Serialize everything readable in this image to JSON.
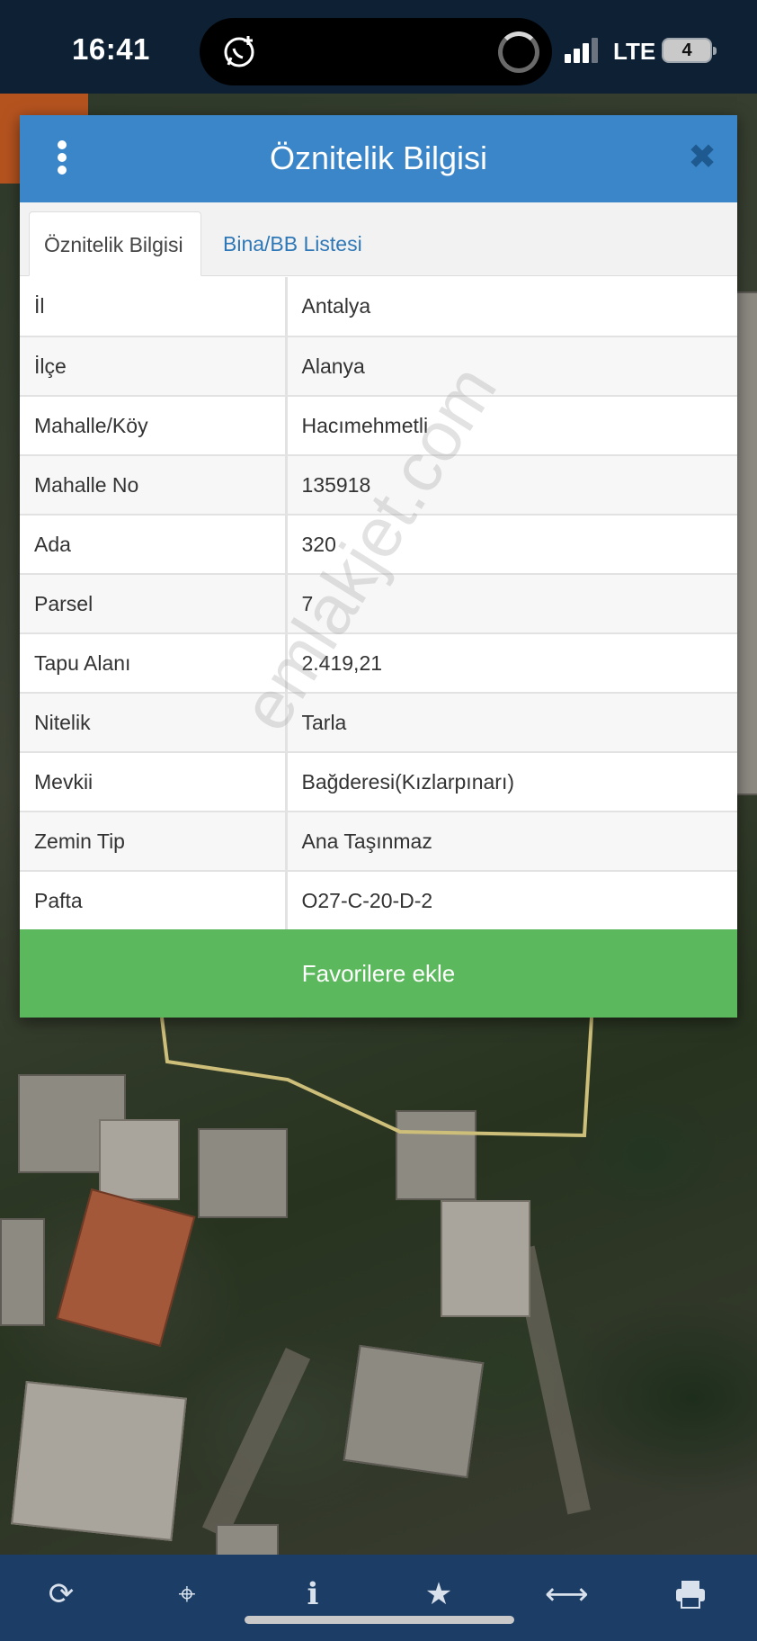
{
  "status_bar": {
    "time": "16:41",
    "network": "LTE",
    "battery": "4"
  },
  "dialog": {
    "title": "Öznitelik Bilgisi",
    "tabs": [
      {
        "label": "Öznitelik Bilgisi",
        "active": true
      },
      {
        "label": "Bina/BB Listesi",
        "active": false
      }
    ],
    "rows": [
      {
        "key": "İl",
        "value": "Antalya"
      },
      {
        "key": "İlçe",
        "value": "Alanya"
      },
      {
        "key": "Mahalle/Köy",
        "value": "Hacımehmetli"
      },
      {
        "key": "Mahalle No",
        "value": "135918"
      },
      {
        "key": "Ada",
        "value": "320"
      },
      {
        "key": "Parsel",
        "value": "7"
      },
      {
        "key": "Tapu Alanı",
        "value": "2.419,21"
      },
      {
        "key": "Nitelik",
        "value": "Tarla"
      },
      {
        "key": "Mevkii",
        "value": "Bağderesi(Kızlarpınarı)"
      },
      {
        "key": "Zemin Tip",
        "value": "Ana Taşınmaz"
      },
      {
        "key": "Pafta",
        "value": "O27-C-20-D-2"
      }
    ],
    "favorite_button": "Favorilere ekle",
    "colors": {
      "header": "#3a86c8",
      "button": "#5cb85c",
      "tab_link": "#2f78b7"
    }
  },
  "watermark": "emlakjet.com",
  "toolbar": {
    "icons": [
      "refresh-icon",
      "locate-icon",
      "info-icon",
      "star-icon",
      "measure-icon",
      "print-icon"
    ],
    "color": "#1c3d66"
  }
}
